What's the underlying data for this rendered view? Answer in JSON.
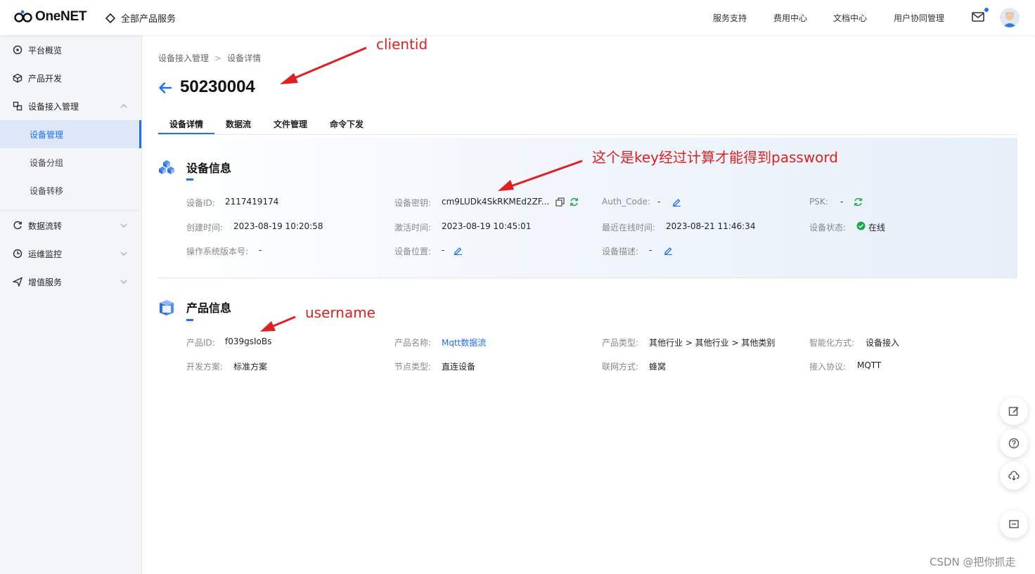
{
  "app": {
    "logo_text": "OneNET",
    "all_products": "全部产品服务"
  },
  "topnav": [
    "服务支持",
    "费用中心",
    "文档中心",
    "用户协同管理"
  ],
  "sidebar": {
    "items": [
      {
        "label": "平台概览",
        "icon": "overview-icon"
      },
      {
        "label": "产品开发",
        "icon": "cube-icon"
      },
      {
        "label": "设备接入管理",
        "icon": "device-access-icon"
      },
      {
        "label": "设备管理"
      },
      {
        "label": "设备分组"
      },
      {
        "label": "设备转移"
      },
      {
        "label": "数据流转",
        "icon": "data-flow-icon"
      },
      {
        "label": "运维监控",
        "icon": "monitor-icon"
      },
      {
        "label": "增值服务",
        "icon": "send-icon"
      }
    ]
  },
  "breadcrumb": {
    "parent": "设备接入管理",
    "sep": ">",
    "current": "设备详情"
  },
  "page_title": "50230004",
  "tabs": [
    "设备详情",
    "数据流",
    "文件管理",
    "命令下发"
  ],
  "device_info": {
    "title": "设备信息",
    "device_id_label": "设备ID:",
    "device_id": "2117419174",
    "device_key_label": "设备密钥:",
    "device_key": "cm9LUDk4SkRKMEd2ZF...",
    "auth_code_label": "Auth_Code:",
    "auth_code": "-",
    "psk_label": "PSK:",
    "psk": "-",
    "created_label": "创建时间:",
    "created": "2023-08-19 10:20:58",
    "activated_label": "激活时间:",
    "activated": "2023-08-19 10:45:01",
    "last_online_label": "最近在线时间:",
    "last_online": "2023-08-21 11:46:34",
    "status_label": "设备状态:",
    "status": "在线",
    "status_color": "#1ea64a",
    "os_version_label": "操作系统版本号:",
    "os_version": "-",
    "location_label": "设备位置:",
    "location": "-",
    "desc_label": "设备描述:",
    "desc": "-"
  },
  "product_info": {
    "title": "产品信息",
    "product_id_label": "产品ID:",
    "product_id": "f039gsIoBs",
    "product_name_label": "产品名称:",
    "product_name": "Mqtt数据流",
    "product_type_label": "产品类型:",
    "product_type": "其他行业 > 其他行业 > 其他类别",
    "smart_label": "智能化方式:",
    "smart": "设备接入",
    "dev_plan_label": "开发方案:",
    "dev_plan": "标准方案",
    "node_type_label": "节点类型:",
    "node_type": "直连设备",
    "network_label": "联网方式:",
    "network": "蜂窝",
    "protocol_label": "接入协议:",
    "protocol": "MQTT"
  },
  "annotations": {
    "clientid": "clientid",
    "password": "这个是key经过计算才能得到password",
    "username": "username",
    "color": "#e02020"
  },
  "watermark": "CSDN @把你抓走",
  "accent": "#1e6fff"
}
